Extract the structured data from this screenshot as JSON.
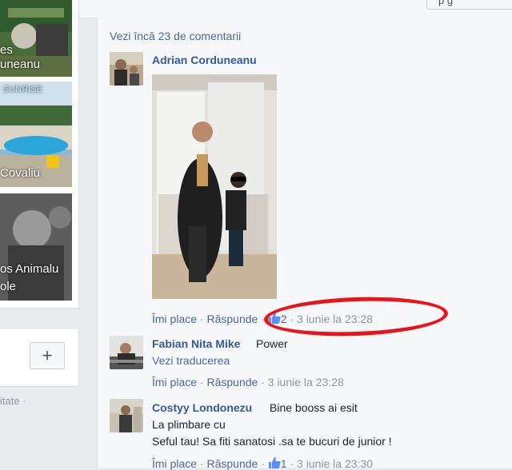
{
  "top_bar": {
    "button_label": "p      g"
  },
  "left_column": {
    "items": [
      {
        "caption_lines": [
          "es",
          "uneanu"
        ]
      },
      {
        "caption_lines": [
          "Covaliu"
        ],
        "sign_text": "SUNRISE"
      },
      {
        "caption_lines": [
          "os Animalu",
          "ole"
        ]
      }
    ],
    "add_button": "+",
    "footer_text": "itate ·"
  },
  "comments_header": {
    "see_more": "Vezi încă 23 de comentarii"
  },
  "comments": [
    {
      "author": "Adrian Corduneanu",
      "text": "",
      "actions": {
        "like": "Îmi place",
        "reply": "Răspunde",
        "like_count": "2",
        "time": "3 iunie la 23:28"
      }
    },
    {
      "author": "Fabian Nita Mike",
      "text": "Power",
      "translate": "Vezi traducerea",
      "actions": {
        "like": "Îmi place",
        "reply": "Răspunde",
        "time": "3 iunie la 23:28"
      }
    },
    {
      "author": "Costyy Londonezu",
      "text_lines": [
        "Bine booss ai esit",
        "La plimbare cu",
        "Seful tau! Sa fiti sanatosi .sa te bucuri de junior !"
      ],
      "actions": {
        "like": "Îmi place",
        "reply": "Răspunde",
        "like_count": "1",
        "time": "3 iunie la 23:30"
      }
    }
  ],
  "colors": {
    "link": "#365899",
    "meta": "#90949c",
    "annotation": "#e8131b"
  }
}
